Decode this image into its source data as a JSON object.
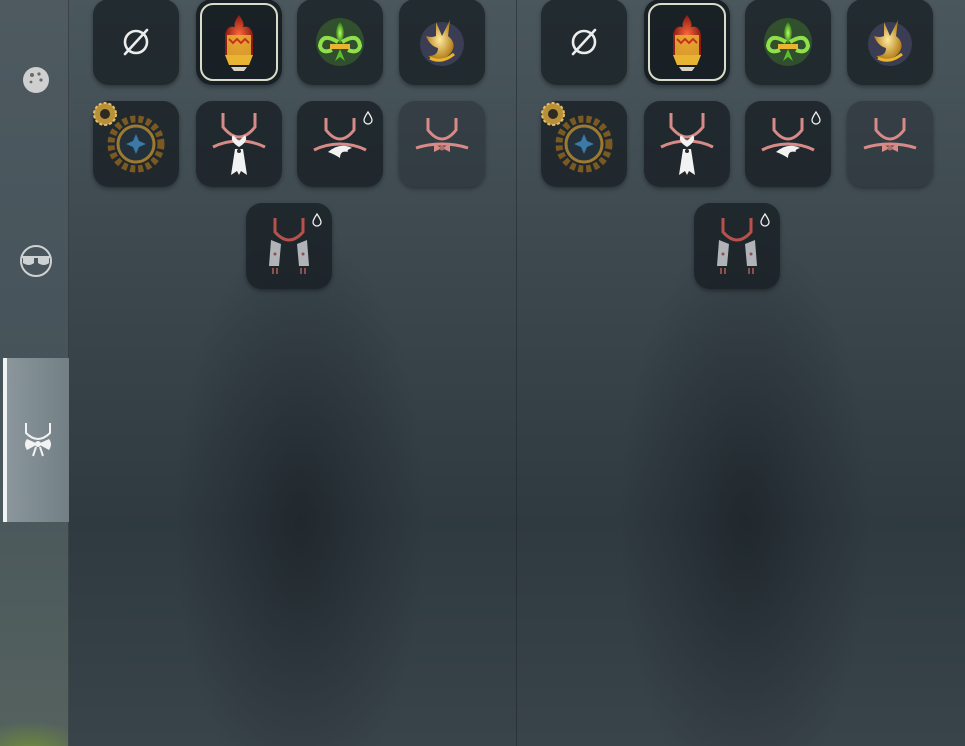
{
  "sidebar": {
    "items": [
      {
        "id": "hair",
        "icon": "hair-icon",
        "active": false
      },
      {
        "id": "glasses",
        "icon": "glasses-icon",
        "active": false
      },
      {
        "id": "necklace",
        "icon": "necklace-bow-icon",
        "active": true
      }
    ]
  },
  "panels": [
    {
      "id": "left",
      "rows": [
        [
          "none-icon",
          "flame-crown-icon",
          "fleur-de-lis-icon",
          "golden-fox-icon"
        ],
        [
          "gear-emblem-icon",
          "heart-tie-necklace-icon",
          "wing-necklace-icon",
          "bow-necklace-icon"
        ],
        [
          "scarf-necklace-icon"
        ]
      ],
      "selected": "flame-crown-icon"
    },
    {
      "id": "right",
      "rows": [
        [
          "none-icon",
          "flame-crown-icon",
          "fleur-de-lis-icon",
          "golden-fox-icon"
        ],
        [
          "gear-emblem-icon",
          "heart-tie-necklace-icon",
          "wing-necklace-icon",
          "bow-necklace-icon"
        ],
        [
          "scarf-necklace-icon"
        ]
      ],
      "selected": "flame-crown-icon"
    }
  ],
  "badges": {
    "drop_items": [
      "wing-necklace-icon",
      "scarf-necklace-icon"
    ]
  },
  "colors": {
    "tile_bg": "#141b1f",
    "selected_border": "#d9dcc9",
    "cord": "#d88b86",
    "gold": "#e9b431",
    "green": "#5fbf2b",
    "red": "#c8321e"
  }
}
